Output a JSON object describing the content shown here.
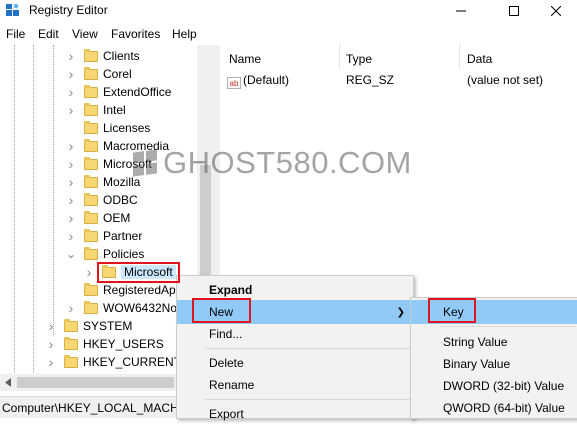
{
  "window": {
    "title": "Registry Editor"
  },
  "menubar": [
    "File",
    "Edit",
    "View",
    "Favorites",
    "Help"
  ],
  "tree": {
    "items": [
      {
        "label": "Clients",
        "expander": "collapsed"
      },
      {
        "label": "Corel",
        "expander": "collapsed"
      },
      {
        "label": "ExtendOffice",
        "expander": "collapsed"
      },
      {
        "label": "Intel",
        "expander": "collapsed"
      },
      {
        "label": "Licenses",
        "expander": "none"
      },
      {
        "label": "Macromedia",
        "expander": "collapsed"
      },
      {
        "label": "Microsoft",
        "expander": "collapsed"
      },
      {
        "label": "Mozilla",
        "expander": "collapsed"
      },
      {
        "label": "ODBC",
        "expander": "collapsed"
      },
      {
        "label": "OEM",
        "expander": "collapsed"
      },
      {
        "label": "Partner",
        "expander": "collapsed"
      },
      {
        "label": "Policies",
        "expander": "expanded"
      },
      {
        "label": "Microsoft",
        "expander": "collapsed",
        "selected": true
      },
      {
        "label": "RegisteredApp",
        "expander": "none"
      },
      {
        "label": "WOW6432No",
        "expander": "collapsed"
      },
      {
        "label": "SYSTEM",
        "expander": "collapsed"
      },
      {
        "label": "HKEY_USERS",
        "expander": "collapsed"
      },
      {
        "label": "HKEY_CURRENT_CON",
        "expander": "collapsed"
      }
    ]
  },
  "list": {
    "headers": {
      "name": "Name",
      "type": "Type",
      "data": "Data"
    },
    "rows": [
      {
        "name": "(Default)",
        "type": "REG_SZ",
        "data": "(value not set)",
        "icon": "ab-string-icon"
      }
    ]
  },
  "context_menu": {
    "items": [
      "Expand",
      "New",
      "Find...",
      "Delete",
      "Rename",
      "Export"
    ]
  },
  "submenu": {
    "items": [
      "Key",
      "String Value",
      "Binary Value",
      "DWORD (32-bit) Value",
      "QWORD (64-bit) Value"
    ]
  },
  "status": {
    "path": "Computer\\HKEY_LOCAL_MACH"
  },
  "watermark": {
    "text": "GHOST580.COM"
  },
  "colors": {
    "highlight": "#e0151b",
    "menu_hover": "#91c9f7",
    "selection": "#cce8ff",
    "folder": "#f7d774"
  }
}
